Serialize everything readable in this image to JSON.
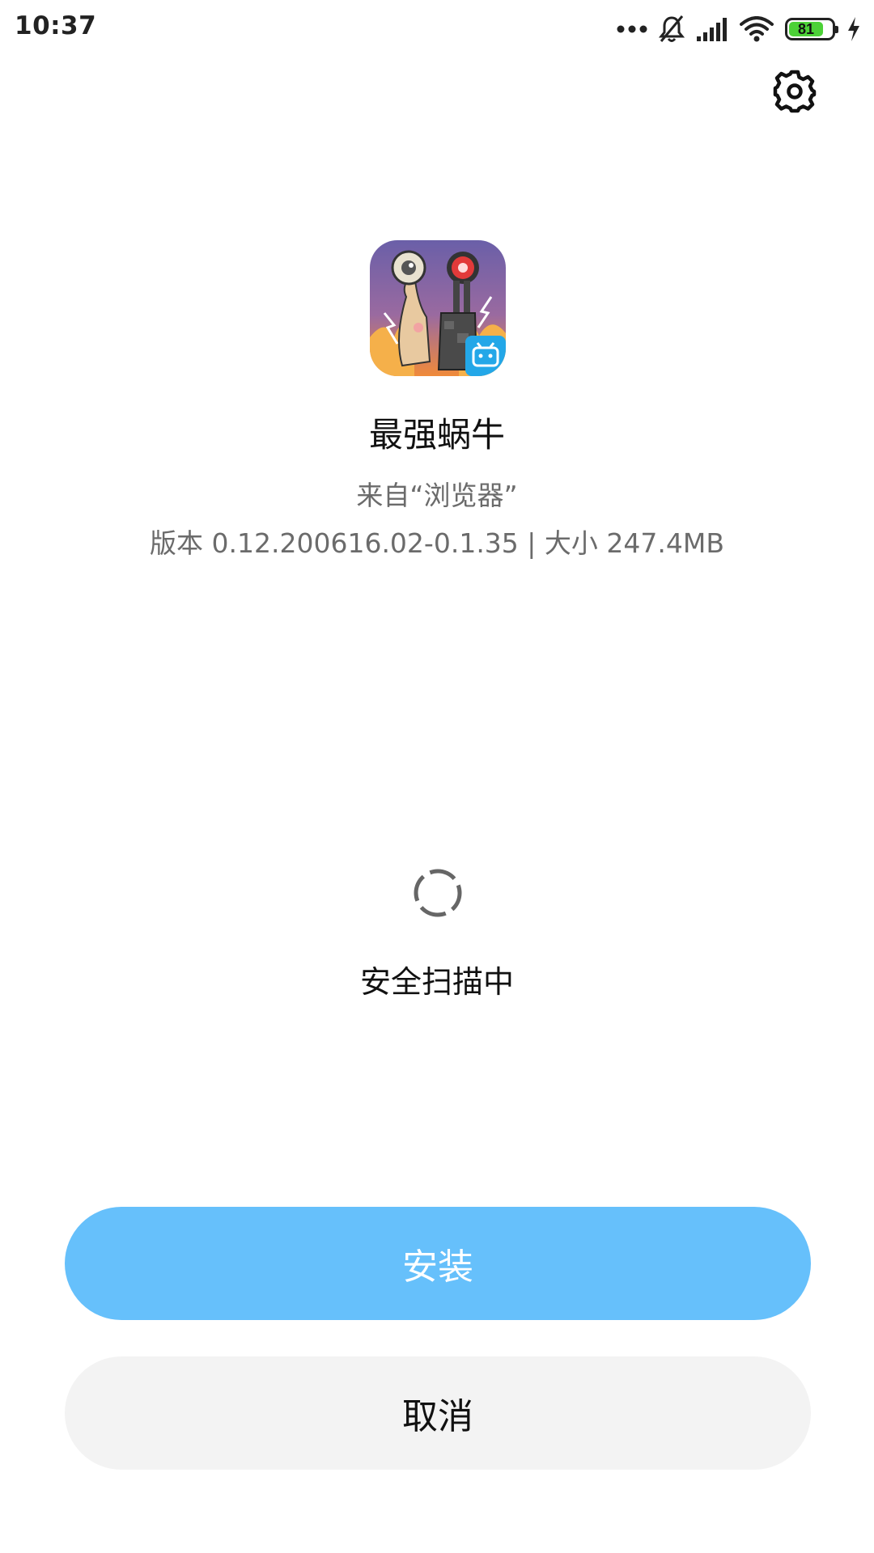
{
  "status_bar": {
    "time": "10:37",
    "battery_level": "81",
    "icons": [
      "more-dots-icon",
      "bell-off-icon",
      "signal-icon",
      "wifi-icon",
      "battery-icon",
      "charging-icon"
    ]
  },
  "header": {
    "settings_icon": "gear-icon"
  },
  "app": {
    "name": "最强蜗牛",
    "source": "来自“浏览器”",
    "meta": "版本 0.12.200616.02-0.1.35 | 大小 247.4MB"
  },
  "scan": {
    "status": "安全扫描中"
  },
  "actions": {
    "install_label": "安装",
    "cancel_label": "取消"
  },
  "colors": {
    "install_button": "#66c0fb",
    "cancel_button": "#f3f3f3",
    "battery_fill": "#4cd137",
    "secondary_text": "#6b6b6b"
  }
}
